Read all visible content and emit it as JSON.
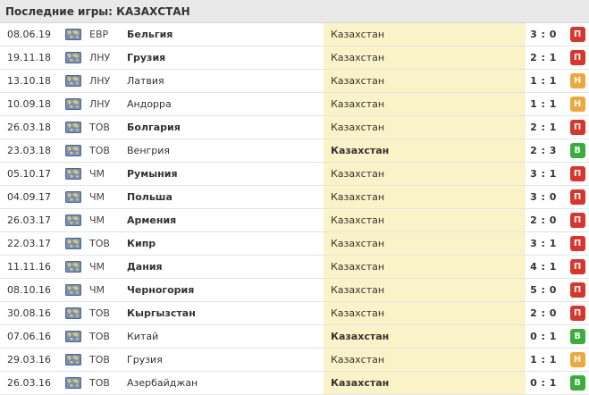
{
  "title": "Последние игры: КАЗАХСТАН",
  "colors": {
    "loss": "#d9352b",
    "draw": "#eea83a",
    "win": "#3aae3a",
    "highlight": "#fbf3c8"
  },
  "icons": {
    "competition": "world-map-icon"
  },
  "matches": [
    {
      "date": "08.06.19",
      "comp": "ЕВР",
      "home": "Бельгия",
      "away": "Казахстан",
      "score": "3 : 0",
      "result": "П",
      "result_type": "loss",
      "winner": "home"
    },
    {
      "date": "19.11.18",
      "comp": "ЛНУ",
      "home": "Грузия",
      "away": "Казахстан",
      "score": "2 : 1",
      "result": "П",
      "result_type": "loss",
      "winner": "home"
    },
    {
      "date": "13.10.18",
      "comp": "ЛНУ",
      "home": "Латвия",
      "away": "Казахстан",
      "score": "1 : 1",
      "result": "Н",
      "result_type": "draw",
      "winner": "none"
    },
    {
      "date": "10.09.18",
      "comp": "ЛНУ",
      "home": "Андорра",
      "away": "Казахстан",
      "score": "1 : 1",
      "result": "Н",
      "result_type": "draw",
      "winner": "none"
    },
    {
      "date": "26.03.18",
      "comp": "ТОВ",
      "home": "Болгария",
      "away": "Казахстан",
      "score": "2 : 1",
      "result": "П",
      "result_type": "loss",
      "winner": "home"
    },
    {
      "date": "23.03.18",
      "comp": "ТОВ",
      "home": "Венгрия",
      "away": "Казахстан",
      "score": "2 : 3",
      "result": "В",
      "result_type": "win",
      "winner": "away"
    },
    {
      "date": "05.10.17",
      "comp": "ЧМ",
      "home": "Румыния",
      "away": "Казахстан",
      "score": "3 : 1",
      "result": "П",
      "result_type": "loss",
      "winner": "home"
    },
    {
      "date": "04.09.17",
      "comp": "ЧМ",
      "home": "Польша",
      "away": "Казахстан",
      "score": "3 : 0",
      "result": "П",
      "result_type": "loss",
      "winner": "home"
    },
    {
      "date": "26.03.17",
      "comp": "ЧМ",
      "home": "Армения",
      "away": "Казахстан",
      "score": "2 : 0",
      "result": "П",
      "result_type": "loss",
      "winner": "home"
    },
    {
      "date": "22.03.17",
      "comp": "ТОВ",
      "home": "Кипр",
      "away": "Казахстан",
      "score": "3 : 1",
      "result": "П",
      "result_type": "loss",
      "winner": "home"
    },
    {
      "date": "11.11.16",
      "comp": "ЧМ",
      "home": "Дания",
      "away": "Казахстан",
      "score": "4 : 1",
      "result": "П",
      "result_type": "loss",
      "winner": "home"
    },
    {
      "date": "08.10.16",
      "comp": "ЧМ",
      "home": "Черногория",
      "away": "Казахстан",
      "score": "5 : 0",
      "result": "П",
      "result_type": "loss",
      "winner": "home"
    },
    {
      "date": "30.08.16",
      "comp": "ТОВ",
      "home": "Кыргызстан",
      "away": "Казахстан",
      "score": "2 : 0",
      "result": "П",
      "result_type": "loss",
      "winner": "home"
    },
    {
      "date": "07.06.16",
      "comp": "ТОВ",
      "home": "Китай",
      "away": "Казахстан",
      "score": "0 : 1",
      "result": "В",
      "result_type": "win",
      "winner": "away"
    },
    {
      "date": "29.03.16",
      "comp": "ТОВ",
      "home": "Грузия",
      "away": "Казахстан",
      "score": "1 : 1",
      "result": "Н",
      "result_type": "draw",
      "winner": "none"
    },
    {
      "date": "26.03.16",
      "comp": "ТОВ",
      "home": "Азербайджан",
      "away": "Казахстан",
      "score": "0 : 1",
      "result": "В",
      "result_type": "win",
      "winner": "away"
    }
  ]
}
